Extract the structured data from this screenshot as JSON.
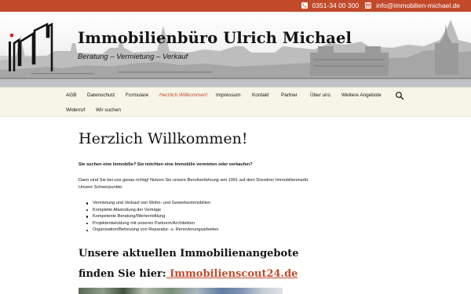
{
  "topbar": {
    "phone": "0351-34 00 300",
    "email": "info@immobilien-michael.de",
    "phone_icon": "phone-icon",
    "email_icon": "envelope-icon",
    "bg_color": "#c24a2b"
  },
  "header": {
    "site_title": "Immobilienbüro Ulrich Michael",
    "tagline": "Beratung – Vermietung – Verkauf"
  },
  "nav": {
    "items_row1": [
      {
        "label": "AGB",
        "active": false
      },
      {
        "label": "Datenschutz",
        "active": false
      },
      {
        "label": "Formulare",
        "active": false
      },
      {
        "label": "Herzlich Willkommen!",
        "active": true
      },
      {
        "label": "Impressum",
        "active": false
      },
      {
        "label": "Kontakt",
        "active": false
      },
      {
        "label": "Partner",
        "active": false
      },
      {
        "label": "Über uns",
        "active": false
      },
      {
        "label": "Weitere Angebote",
        "active": false
      }
    ],
    "items_row2": [
      {
        "label": "Widerruf",
        "active": false
      },
      {
        "label": "Wir suchen",
        "active": false
      }
    ],
    "search_icon": "search-icon"
  },
  "content": {
    "title": "Herzlich Willkommen!",
    "intro_bold": "Sie suchen eine Immobilie?  Sie möchten eine Immobilie vermieten oder verkaufen?",
    "intro_text": "Dann sind Sie bei uns genau richtig! Nutzen Sie unsere Berufserfahrung seit 1991 auf dem Dresdner Immobilienmarkt.",
    "focus_heading": "Unsere Schwerpunkte:",
    "focus_list": [
      "Vermietung  und Verkauf von Wohn- und Gewerbeimmobilien",
      "Komplette Abwicklung der Verträge",
      "Kompetente Beratung/Wertermittlung",
      "Projektentwicklung mit unseren Partnern/Architekten",
      "Organisation/Betreuung von Reparatur- u. Renovierungsarbeiten"
    ],
    "offers_heading": "Unsere aktuellen Immobilienangebote",
    "find_prefix": "finden Sie hier:",
    "find_link": " Immobilienscout24.de",
    "accent_color": "#c24a2b"
  }
}
